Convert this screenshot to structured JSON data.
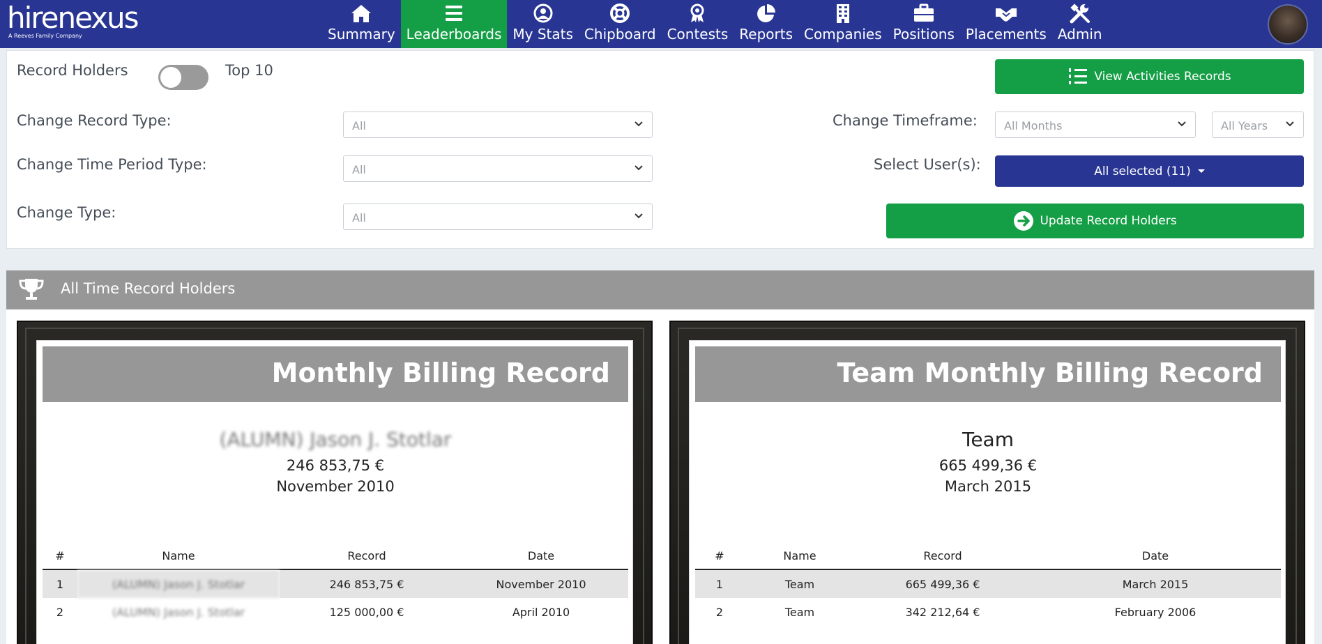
{
  "nav": {
    "logo": "hirenexus",
    "logo_sub": "A Reeves Family Company",
    "items": [
      {
        "label": "Summary",
        "icon": "home-icon"
      },
      {
        "label": "Leaderboards",
        "icon": "list-icon",
        "active": true
      },
      {
        "label": "My Stats",
        "icon": "user-circle-icon"
      },
      {
        "label": "Chipboard",
        "icon": "life-ring-icon"
      },
      {
        "label": "Contests",
        "icon": "award-icon"
      },
      {
        "label": "Reports",
        "icon": "pie-chart-icon"
      },
      {
        "label": "Companies",
        "icon": "building-icon"
      },
      {
        "label": "Positions",
        "icon": "briefcase-icon"
      },
      {
        "label": "Placements",
        "icon": "handshake-icon"
      },
      {
        "label": "Admin",
        "icon": "tools-icon"
      }
    ]
  },
  "filters": {
    "record_holders": "Record Holders",
    "top10": "Top 10",
    "view_activities": "View Activities Records",
    "change_record_type": "Change Record Type:",
    "record_type_value": "All",
    "change_timeframe": "Change Timeframe:",
    "timeframe_months": "All Months",
    "timeframe_years": "All Years",
    "change_time_period_type": "Change Time Period Type:",
    "time_period_value": "All",
    "select_users": "Select User(s):",
    "users_value": "All selected (11)",
    "change_type": "Change Type:",
    "type_value": "All",
    "update_button": "Update Record Holders"
  },
  "section": {
    "title": "All Time Record Holders"
  },
  "cards": [
    {
      "title": "Monthly Billing Record",
      "holder_name": "(ALUMN) Jason J. Stotlar",
      "holder_value": "246 853,75 €",
      "holder_date": "November 2010",
      "columns": [
        "#",
        "Name",
        "Record",
        "Date"
      ],
      "rows": [
        {
          "rank": "1",
          "name": "(ALUMN) Jason J. Stotlar",
          "record": "246 853,75 €",
          "date": "November 2010"
        },
        {
          "rank": "2",
          "name": "(ALUMN) Jason J. Stotlar",
          "record": "125 000,00 €",
          "date": "April 2010"
        }
      ]
    },
    {
      "title": "Team Monthly Billing Record",
      "holder_name": "Team",
      "holder_value": "665 499,36 €",
      "holder_date": "March 2015",
      "columns": [
        "#",
        "Name",
        "Record",
        "Date"
      ],
      "rows": [
        {
          "rank": "1",
          "name": "Team",
          "record": "665 499,36 €",
          "date": "March 2015"
        },
        {
          "rank": "2",
          "name": "Team",
          "record": "342 212,64 €",
          "date": "February 2006"
        }
      ]
    }
  ],
  "colors": {
    "navbar": "#283593",
    "active": "#149e45",
    "green_button": "#149e45",
    "header_gray": "#979797"
  }
}
